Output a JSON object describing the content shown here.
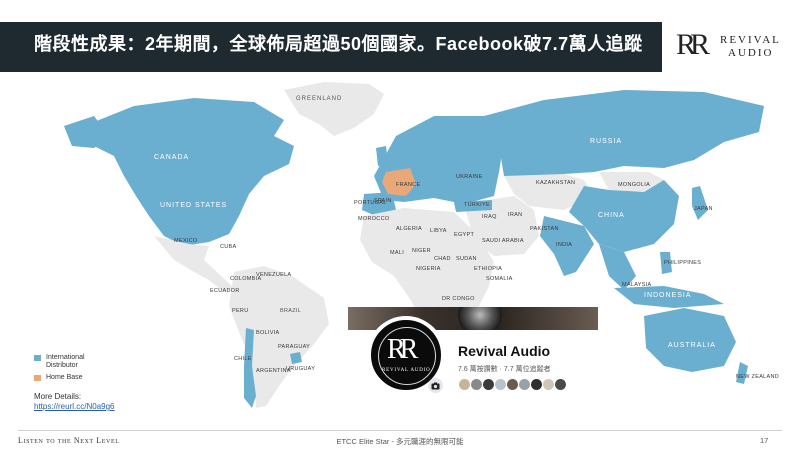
{
  "header": {
    "title": "階段性成果：2年期間，全球佈局超過50個國家。Facebook破7.7萬人追蹤",
    "logo": {
      "line1": "REVIVAL",
      "line2": "AUDIO",
      "mark": "RR"
    }
  },
  "map": {
    "colors": {
      "distributor": "#6aaed0",
      "home_base": "#e8a877",
      "other_land": "#e9e9e9",
      "ocean": "#ffffff"
    },
    "labels": [
      {
        "text": "GREENLAND",
        "style": "dark"
      },
      {
        "text": "CANADA",
        "style": "big"
      },
      {
        "text": "UNITED STATES",
        "style": "big"
      },
      {
        "text": "MEXICO",
        "style": "small"
      },
      {
        "text": "CUBA",
        "style": "small"
      },
      {
        "text": "VENEZUELA",
        "style": "small"
      },
      {
        "text": "COLOMBIA",
        "style": "small"
      },
      {
        "text": "ECUADOR",
        "style": "small"
      },
      {
        "text": "PERU",
        "style": "small"
      },
      {
        "text": "BRAZIL",
        "style": "big"
      },
      {
        "text": "BOLIVIA",
        "style": "small"
      },
      {
        "text": "PARAGUAY",
        "style": "small"
      },
      {
        "text": "CHILE",
        "style": "small"
      },
      {
        "text": "ARGENTINA",
        "style": "small"
      },
      {
        "text": "URUGUAY",
        "style": "small"
      },
      {
        "text": "FRANCE",
        "style": "small"
      },
      {
        "text": "SPAIN",
        "style": "small"
      },
      {
        "text": "PORTUGAL",
        "style": "small"
      },
      {
        "text": "UKRAINE",
        "style": "small"
      },
      {
        "text": "TÜRKIYE",
        "style": "small"
      },
      {
        "text": "MOROCCO",
        "style": "small"
      },
      {
        "text": "ALGERIA",
        "style": "small"
      },
      {
        "text": "LIBYA",
        "style": "small"
      },
      {
        "text": "EGYPT",
        "style": "small"
      },
      {
        "text": "SAUDI ARABIA",
        "style": "small"
      },
      {
        "text": "IRAQ",
        "style": "small"
      },
      {
        "text": "IRAN",
        "style": "small"
      },
      {
        "text": "MALI",
        "style": "small"
      },
      {
        "text": "NIGER",
        "style": "small"
      },
      {
        "text": "CHAD",
        "style": "small"
      },
      {
        "text": "SUDAN",
        "style": "small"
      },
      {
        "text": "NIGERIA",
        "style": "small"
      },
      {
        "text": "ETHIOPIA",
        "style": "small"
      },
      {
        "text": "SOMALIA",
        "style": "small"
      },
      {
        "text": "DR CONGO",
        "style": "small"
      },
      {
        "text": "KAZAKHSTAN",
        "style": "small"
      },
      {
        "text": "RUSSIA",
        "style": "big"
      },
      {
        "text": "MONGOLIA",
        "style": "small"
      },
      {
        "text": "CHINA",
        "style": "big"
      },
      {
        "text": "PAKISTAN",
        "style": "small"
      },
      {
        "text": "INDIA",
        "style": "small"
      },
      {
        "text": "JAPAN",
        "style": "small"
      },
      {
        "text": "PHILIPPINES",
        "style": "small"
      },
      {
        "text": "MALAYSIA",
        "style": "small"
      },
      {
        "text": "INDONESIA",
        "style": "big"
      },
      {
        "text": "AUSTRALIA",
        "style": "big"
      },
      {
        "text": "NEW ZEALAND",
        "style": "small"
      }
    ]
  },
  "legend": {
    "items": [
      {
        "label": "International Distributor",
        "color": "#6aaed0"
      },
      {
        "label": "Home Base",
        "color": "#e8a877"
      }
    ]
  },
  "details": {
    "label": "More Details:",
    "link": "https://reurl.cc/N0a9g6"
  },
  "facebook": {
    "name": "Revival Audio",
    "stats": "7.6 萬按讚數 · 7.7 萬位追蹤者",
    "avatar_mark": "RR",
    "avatar_text": "REVIVAL AUDIO",
    "friend_colors": [
      "#c7b59a",
      "#8a8a8a",
      "#3b3b3b",
      "#b9c3cc",
      "#6b5b4f",
      "#9aa2a8",
      "#2f2f2f",
      "#d1c7b8",
      "#4a4a4a"
    ]
  },
  "footer": {
    "left": "Listen to the Next Level",
    "center": "ETCC Elite Star - 多元職涯的無限可能",
    "page": "17"
  }
}
